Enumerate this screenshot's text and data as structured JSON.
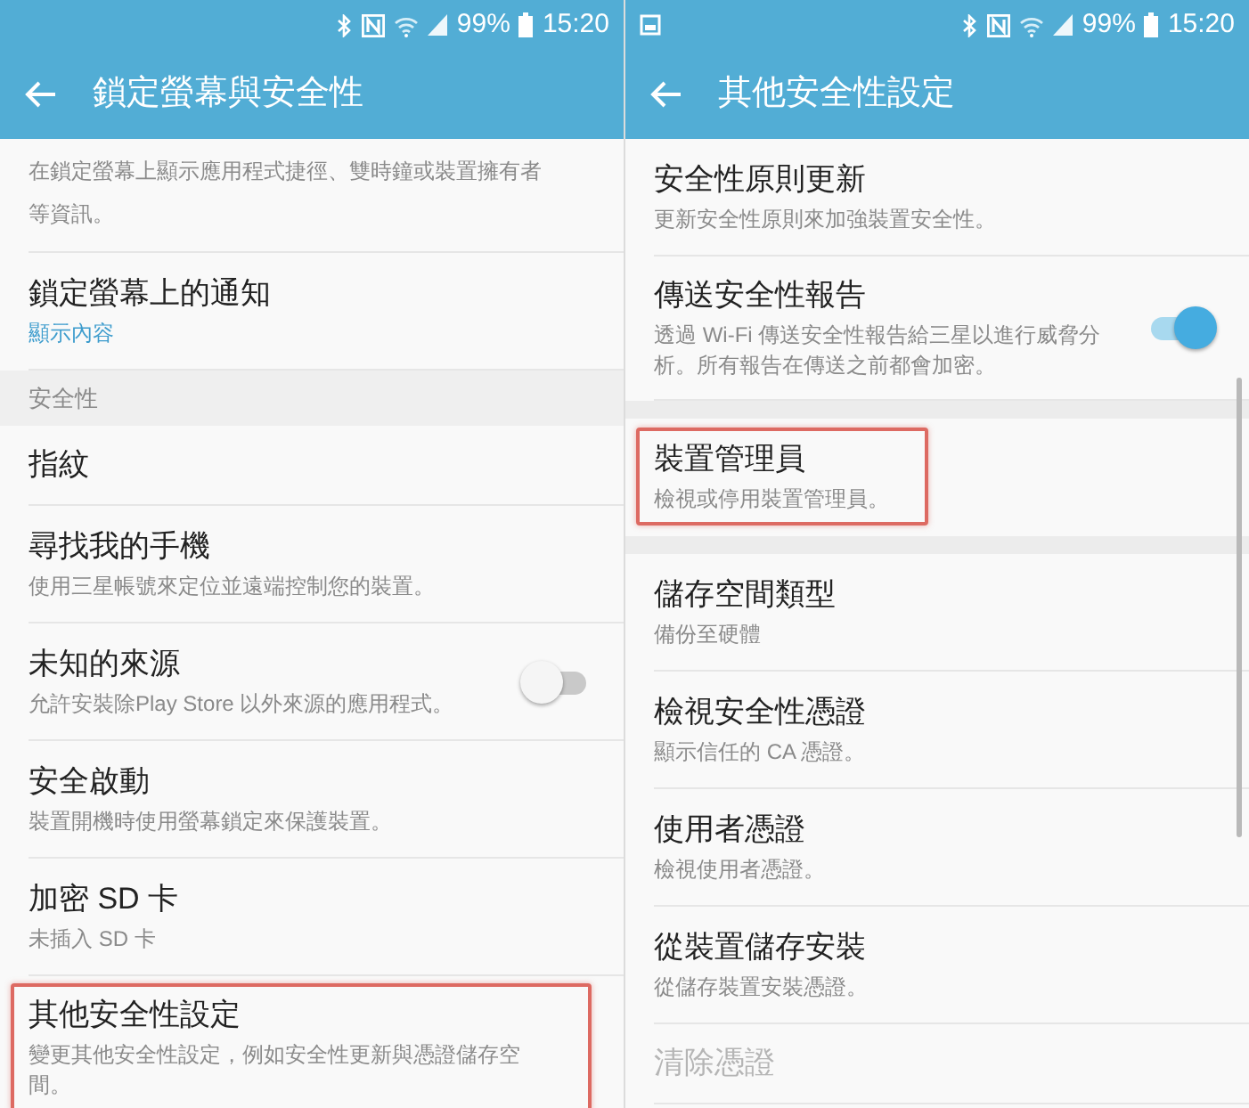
{
  "panels": [
    {
      "status_bar": {
        "battery": "99%",
        "time": "15:20"
      },
      "toolbar": {
        "title": "鎖定螢幕與安全性"
      },
      "items": [
        {
          "kind": "partial",
          "summary": "在鎖定螢幕上顯示應用程式捷徑、雙時鐘或裝置擁有者等資訊。"
        },
        {
          "kind": "item",
          "title": "鎖定螢幕上的通知",
          "summary": "顯示內容",
          "accent": true,
          "highlighted": false,
          "disabled": false
        },
        {
          "kind": "section",
          "title": "安全性"
        },
        {
          "kind": "item",
          "title": "指紋",
          "highlighted": false,
          "disabled": false
        },
        {
          "kind": "item",
          "title": "尋找我的手機",
          "summary": "使用三星帳號來定位並遠端控制您的裝置。",
          "highlighted": false,
          "disabled": false
        },
        {
          "kind": "item",
          "title": "未知的來源",
          "summary": "允許安裝除Play Store 以外來源的應用程式。",
          "toggle": {
            "on": false
          },
          "highlighted": false,
          "disabled": false
        },
        {
          "kind": "item",
          "title": "安全啟動",
          "summary": "裝置開機時使用螢幕鎖定來保護裝置。",
          "highlighted": false,
          "disabled": false
        },
        {
          "kind": "item",
          "title": "加密 SD 卡",
          "summary": "未插入 SD 卡",
          "highlighted": false,
          "disabled": false
        },
        {
          "kind": "item",
          "title": "其他安全性設定",
          "summary": "變更其他安全性設定，例如安全性更新與憑證儲存空間。",
          "highlighted": true,
          "disabled": false
        }
      ]
    },
    {
      "status_bar": {
        "notification_icon": true,
        "battery": "99%",
        "time": "15:20"
      },
      "toolbar": {
        "title": "其他安全性設定"
      },
      "scrollbar": true,
      "items": [
        {
          "kind": "item",
          "title": "安全性原則更新",
          "summary": "更新安全性原則來加強裝置安全性。",
          "highlighted": false,
          "disabled": false
        },
        {
          "kind": "item",
          "title": "傳送安全性報告",
          "summary": "透過 Wi-Fi 傳送安全性報告給三星以進行威脅分析。所有報告在傳送之前都會加密。",
          "toggle": {
            "on": true
          },
          "highlighted": false,
          "disabled": false
        },
        {
          "kind": "gap"
        },
        {
          "kind": "item",
          "title": "裝置管理員",
          "summary": "檢視或停用裝置管理員。",
          "highlighted": true,
          "disabled": false
        },
        {
          "kind": "gap"
        },
        {
          "kind": "item",
          "title": "儲存空間類型",
          "summary": "備份至硬體",
          "highlighted": false,
          "disabled": false
        },
        {
          "kind": "item",
          "title": "檢視安全性憑證",
          "summary": "顯示信任的 CA 憑證。",
          "highlighted": false,
          "disabled": false
        },
        {
          "kind": "item",
          "title": "使用者憑證",
          "summary": "檢視使用者憑證。",
          "highlighted": false,
          "disabled": false
        },
        {
          "kind": "item",
          "title": "從裝置儲存安裝",
          "summary": "從儲存裝置安裝憑證。",
          "highlighted": false,
          "disabled": false
        },
        {
          "kind": "item",
          "title": "清除憑證",
          "highlighted": false,
          "disabled": true
        }
      ]
    }
  ]
}
